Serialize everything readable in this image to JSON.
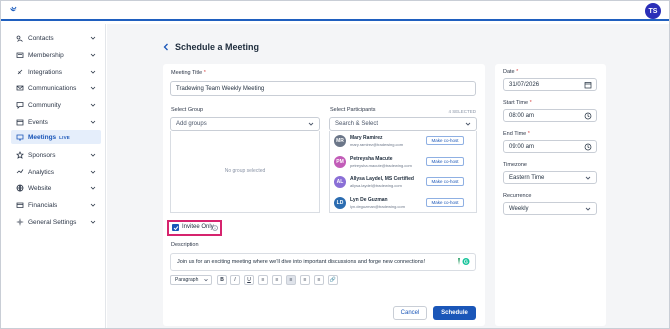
{
  "header": {
    "avatar_initials": "TS",
    "brand_color": "#1f5fbf"
  },
  "sidebar": {
    "items": [
      {
        "label": "Contacts",
        "icon": "contacts-icon"
      },
      {
        "label": "Membership",
        "icon": "membership-icon"
      },
      {
        "label": "Integrations",
        "icon": "integrations-icon"
      },
      {
        "label": "Communications",
        "icon": "communications-icon"
      },
      {
        "label": "Community",
        "icon": "community-icon"
      },
      {
        "label": "Events",
        "icon": "events-icon"
      },
      {
        "label": "Meetings",
        "icon": "meetings-icon",
        "badge": "LIVE",
        "active": true
      },
      {
        "label": "Sponsors",
        "icon": "sponsors-icon"
      },
      {
        "label": "Analytics",
        "icon": "analytics-icon"
      },
      {
        "label": "Website",
        "icon": "website-icon"
      },
      {
        "label": "Financials",
        "icon": "financials-icon"
      },
      {
        "label": "General Settings",
        "icon": "settings-icon"
      }
    ]
  },
  "page": {
    "title": "Schedule a Meeting"
  },
  "form": {
    "meeting_title_label": "Meeting Title",
    "required_mark": "*",
    "meeting_title_value": "Tradewing Team Weekly Meeting",
    "group_label": "Select Group",
    "group_placeholder": "Add groups",
    "no_group_text": "No group selected",
    "participants_label": "Select Participants",
    "selected_count": "4 SELECTED",
    "participants_placeholder": "Search & Select",
    "participants": [
      {
        "initials": "MR",
        "name": "Mary Ramirez",
        "email": "mary.ramirez@tradewing.com",
        "color": "#6b7688",
        "action": "Make co-host"
      },
      {
        "initials": "PM",
        "name": "Petreysha Macute",
        "email": "petreysha.macute@tradewing.com",
        "color": "#c25cb8",
        "action": "Make co-host"
      },
      {
        "initials": "AL",
        "name": "Allysa Laydel, MS Certified",
        "email": "allysa.laydel@tradewing.com",
        "color": "#8a6fd6",
        "action": "Make co-host"
      },
      {
        "initials": "LD",
        "name": "Lyn De Guzman",
        "email": "lyn.deguzman@tradewing.com",
        "color": "#2b6cb0",
        "action": "Make co-host"
      }
    ],
    "invitee_only_label": "Invitee Only",
    "invitee_only_checked": true,
    "description_label": "Description",
    "description_value": "Join us for an exciting meeting where we'll dive into important discussions and forge new connections!",
    "toolbar": {
      "paragraph_style": "Paragraph",
      "buttons": [
        "B",
        "I",
        "U",
        "≡",
        "≡",
        "≡",
        "≡",
        "≡",
        "🔗"
      ]
    },
    "cancel_label": "Cancel",
    "schedule_label": "Schedule"
  },
  "settings": {
    "date_label": "Date",
    "date_value": "31/07/2026",
    "start_label": "Start Time",
    "start_value": "08:00 am",
    "end_label": "End Time",
    "end_value": "09:00 am",
    "timezone_label": "Timezone",
    "timezone_value": "Eastern Time",
    "recurrence_label": "Recurrence",
    "recurrence_value": "Weekly"
  }
}
